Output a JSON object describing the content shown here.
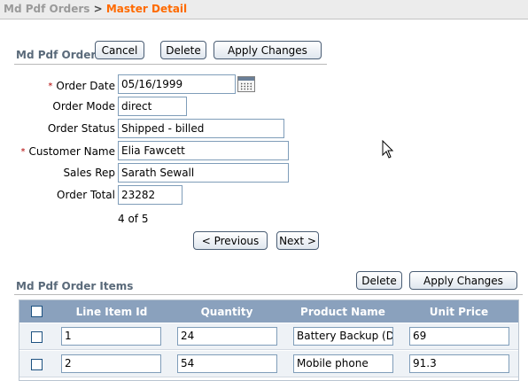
{
  "breadcrumb": {
    "parent": "Md Pdf Orders",
    "separator": " > ",
    "current": "Master Detail"
  },
  "master": {
    "title": "Md Pdf Orders",
    "buttons": {
      "cancel": "Cancel",
      "delete": "Delete",
      "apply": "Apply Changes"
    },
    "fields": {
      "order_date": {
        "label": "Order Date",
        "value": "05/16/1999",
        "required": true
      },
      "order_mode": {
        "label": "Order Mode",
        "value": "direct"
      },
      "order_status": {
        "label": "Order Status",
        "value": "Shipped - billed"
      },
      "customer_name": {
        "label": "Customer Name",
        "value": "Elia Fawcett",
        "required": true
      },
      "sales_rep": {
        "label": "Sales Rep",
        "value": "Sarath Sewall"
      },
      "order_total": {
        "label": "Order Total",
        "value": "23282"
      }
    },
    "required_marker": "*",
    "record_counter": "4 of 5",
    "nav": {
      "previous": "< Previous",
      "next": "Next >"
    }
  },
  "detail": {
    "title": "Md Pdf Order Items",
    "buttons": {
      "delete": "Delete",
      "apply": "Apply Changes"
    },
    "columns": [
      "Line Item Id",
      "Quantity",
      "Product Name",
      "Unit Price"
    ],
    "rows": [
      {
        "line_item_id": "1",
        "quantity": "24",
        "product_name": "Battery Backup (DA-",
        "unit_price": "69"
      },
      {
        "line_item_id": "2",
        "quantity": "54",
        "product_name": "Mobile phone",
        "unit_price": "91.3"
      }
    ]
  },
  "colors": {
    "breadcrumb_current": "#ff6a00",
    "header_bg": "#8aa1bd",
    "row_bg": "#eef2f6",
    "required": "#b00000"
  }
}
